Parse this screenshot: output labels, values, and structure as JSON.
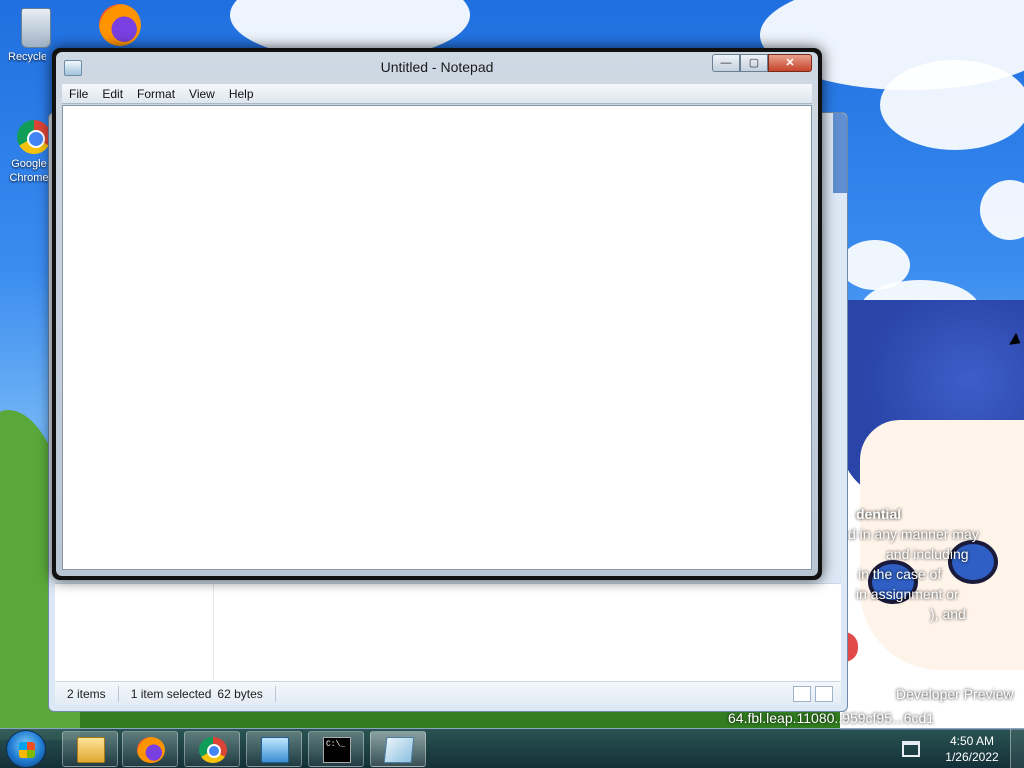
{
  "desktop": {
    "icons": [
      {
        "label": "Recycle Bin",
        "icon": "recycle-bin-icon"
      },
      {
        "label": "Firefox",
        "icon": "firefox-icon"
      },
      {
        "label": "Google Chrome",
        "icon": "chrome-icon"
      }
    ],
    "wallpaper_text": [
      "dential",
      "d in any manner may",
      "and including",
      "in the case of",
      "in assignment or",
      "), and",
      "Developer Preview",
      "64.fbl.leap.11080..959cf95...6cd1"
    ]
  },
  "explorer": {
    "status_items_count": "2 items",
    "status_selection": "1 item selected",
    "status_size": "62 bytes"
  },
  "notepad": {
    "title": "Untitled - Notepad",
    "menu": [
      "File",
      "Edit",
      "Format",
      "View",
      "Help"
    ],
    "content": "",
    "caption_buttons": {
      "minimize": "—",
      "maximize": "▢",
      "close": "✕"
    }
  },
  "taskbar": {
    "items": [
      {
        "name": "windows-explorer",
        "icon": "folder-icon",
        "active": false
      },
      {
        "name": "firefox",
        "icon": "firefox-icon",
        "active": false
      },
      {
        "name": "chrome",
        "icon": "chrome-icon",
        "active": false
      },
      {
        "name": "installer",
        "icon": "installer-icon",
        "active": false
      },
      {
        "name": "command-prompt",
        "icon": "cmd-icon",
        "label": "C:\\_",
        "active": false
      },
      {
        "name": "notepad",
        "icon": "notepad-icon",
        "active": true
      }
    ],
    "clock": {
      "time": "4:50 AM",
      "date": "1/26/2022"
    }
  }
}
